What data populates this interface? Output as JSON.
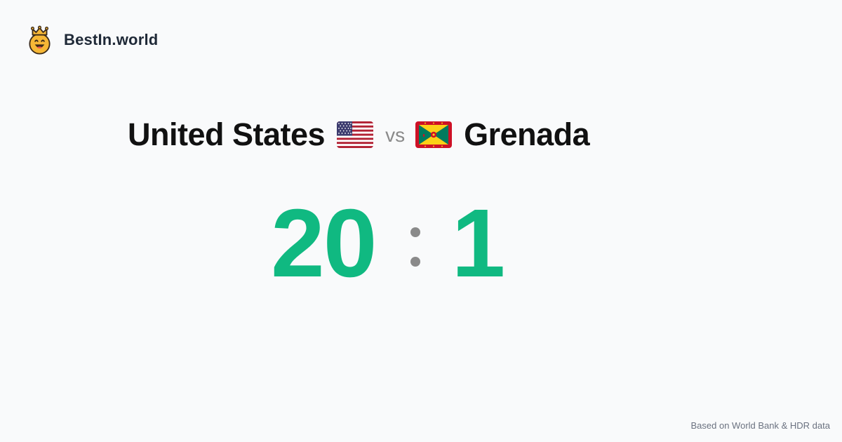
{
  "site": {
    "logo_icon": "crown-smiley-icon",
    "name": "BestIn.world"
  },
  "comparison": {
    "left": {
      "name": "United States",
      "flag_icon": "us-flag-icon"
    },
    "separator": "vs",
    "right": {
      "name": "Grenada",
      "flag_icon": "grenada-flag-icon"
    }
  },
  "score": {
    "left": "20",
    "right": "1",
    "color": "#10b981"
  },
  "footer": {
    "source": "Based on World Bank & HDR data"
  }
}
